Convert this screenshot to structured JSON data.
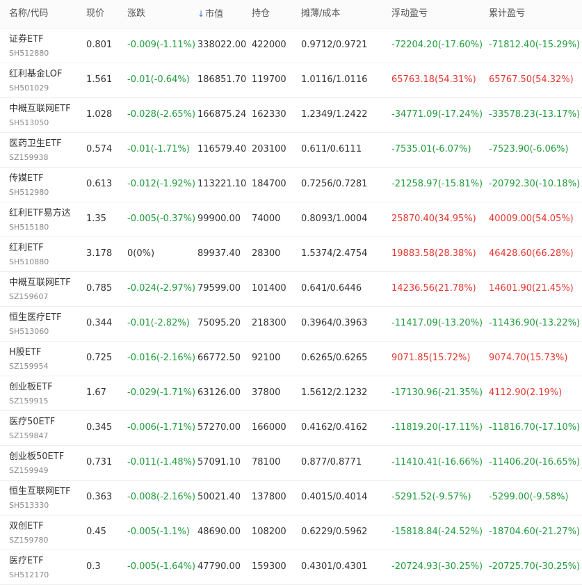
{
  "colors": {
    "up": "#e8362f",
    "down": "#1f9c3a",
    "flat": "#333333",
    "sort": "#2f7fd6"
  },
  "header": {
    "name_code": "名称/代码",
    "price": "现价",
    "change": "涨跌",
    "sort_icon": "↓",
    "market_value": "市值",
    "position": "持仓",
    "cost": "摊薄/成本",
    "float_pnl": "浮动盈亏",
    "total_pnl": "累计盈亏"
  },
  "rows": [
    {
      "name": "证券ETF",
      "code": "SH512880",
      "price": "0.801",
      "change": "-0.009(-1.11%)",
      "change_dir": "down",
      "mv": "338022.00",
      "pos": "422000",
      "cost": "0.9712/0.9721",
      "float": "-72204.20(-17.60%)",
      "float_dir": "down",
      "total": "-71812.40(-15.29%)",
      "total_dir": "down"
    },
    {
      "name": "红利基金LOF",
      "code": "SH501029",
      "price": "1.561",
      "change": "-0.01(-0.64%)",
      "change_dir": "down",
      "mv": "186851.70",
      "pos": "119700",
      "cost": "1.0116/1.0116",
      "float": "65763.18(54.31%)",
      "float_dir": "up",
      "total": "65767.50(54.32%)",
      "total_dir": "up"
    },
    {
      "name": "中概互联网ETF",
      "code": "SH513050",
      "price": "1.028",
      "change": "-0.028(-2.65%)",
      "change_dir": "down",
      "mv": "166875.24",
      "pos": "162330",
      "cost": "1.2349/1.2422",
      "float": "-34771.09(-17.24%)",
      "float_dir": "down",
      "total": "-33578.23(-13.17%)",
      "total_dir": "down"
    },
    {
      "name": "医药卫生ETF",
      "code": "SZ159938",
      "price": "0.574",
      "change": "-0.01(-1.71%)",
      "change_dir": "down",
      "mv": "116579.40",
      "pos": "203100",
      "cost": "0.611/0.6111",
      "float": "-7535.01(-6.07%)",
      "float_dir": "down",
      "total": "-7523.90(-6.06%)",
      "total_dir": "down"
    },
    {
      "name": "传媒ETF",
      "code": "SH512980",
      "price": "0.613",
      "change": "-0.012(-1.92%)",
      "change_dir": "down",
      "mv": "113221.10",
      "pos": "184700",
      "cost": "0.7256/0.7281",
      "float": "-21258.97(-15.81%)",
      "float_dir": "down",
      "total": "-20792.30(-10.18%)",
      "total_dir": "down"
    },
    {
      "name": "红利ETF易方达",
      "code": "SH515180",
      "price": "1.35",
      "change": "-0.005(-0.37%)",
      "change_dir": "down",
      "mv": "99900.00",
      "pos": "74000",
      "cost": "0.8093/1.0004",
      "float": "25870.40(34.95%)",
      "float_dir": "up",
      "total": "40009.00(54.05%)",
      "total_dir": "up"
    },
    {
      "name": "红利ETF",
      "code": "SH510880",
      "price": "3.178",
      "change": "0(0%)",
      "change_dir": "flat",
      "mv": "89937.40",
      "pos": "28300",
      "cost": "1.5374/2.4754",
      "float": "19883.58(28.38%)",
      "float_dir": "up",
      "total": "46428.60(66.28%)",
      "total_dir": "up"
    },
    {
      "name": "中概互联网ETF",
      "code": "SZ159607",
      "price": "0.785",
      "change": "-0.024(-2.97%)",
      "change_dir": "down",
      "mv": "79599.00",
      "pos": "101400",
      "cost": "0.641/0.6446",
      "float": "14236.56(21.78%)",
      "float_dir": "up",
      "total": "14601.90(21.45%)",
      "total_dir": "up"
    },
    {
      "name": "恒生医疗ETF",
      "code": "SH513060",
      "price": "0.344",
      "change": "-0.01(-2.82%)",
      "change_dir": "down",
      "mv": "75095.20",
      "pos": "218300",
      "cost": "0.3964/0.3963",
      "float": "-11417.09(-13.20%)",
      "float_dir": "down",
      "total": "-11436.90(-13.22%)",
      "total_dir": "down"
    },
    {
      "name": "H股ETF",
      "code": "SZ159954",
      "price": "0.725",
      "change": "-0.016(-2.16%)",
      "change_dir": "down",
      "mv": "66772.50",
      "pos": "92100",
      "cost": "0.6265/0.6265",
      "float": "9071.85(15.72%)",
      "float_dir": "up",
      "total": "9074.70(15.73%)",
      "total_dir": "up"
    },
    {
      "name": "创业板ETF",
      "code": "SZ159915",
      "price": "1.67",
      "change": "-0.029(-1.71%)",
      "change_dir": "down",
      "mv": "63126.00",
      "pos": "37800",
      "cost": "1.5612/2.1232",
      "float": "-17130.96(-21.35%)",
      "float_dir": "down",
      "total": "4112.90(2.19%)",
      "total_dir": "up"
    },
    {
      "name": "医疗50ETF",
      "code": "SZ159847",
      "price": "0.345",
      "change": "-0.006(-1.71%)",
      "change_dir": "down",
      "mv": "57270.00",
      "pos": "166000",
      "cost": "0.4162/0.4162",
      "float": "-11819.20(-17.11%)",
      "float_dir": "down",
      "total": "-11816.70(-17.10%)",
      "total_dir": "down"
    },
    {
      "name": "创业板50ETF",
      "code": "SZ159949",
      "price": "0.731",
      "change": "-0.011(-1.48%)",
      "change_dir": "down",
      "mv": "57091.10",
      "pos": "78100",
      "cost": "0.877/0.8771",
      "float": "-11410.41(-16.66%)",
      "float_dir": "down",
      "total": "-11406.20(-16.65%)",
      "total_dir": "down"
    },
    {
      "name": "恒生互联网ETF",
      "code": "SH513330",
      "price": "0.363",
      "change": "-0.008(-2.16%)",
      "change_dir": "down",
      "mv": "50021.40",
      "pos": "137800",
      "cost": "0.4015/0.4014",
      "float": "-5291.52(-9.57%)",
      "float_dir": "down",
      "total": "-5299.00(-9.58%)",
      "total_dir": "down"
    },
    {
      "name": "双创ETF",
      "code": "SZ159780",
      "price": "0.45",
      "change": "-0.005(-1.1%)",
      "change_dir": "down",
      "mv": "48690.00",
      "pos": "108200",
      "cost": "0.6229/0.5962",
      "float": "-15818.84(-24.52%)",
      "float_dir": "down",
      "total": "-18704.60(-21.27%)",
      "total_dir": "down"
    },
    {
      "name": "医疗ETF",
      "code": "SH512170",
      "price": "0.3",
      "change": "-0.005(-1.64%)",
      "change_dir": "down",
      "mv": "47790.00",
      "pos": "159300",
      "cost": "0.4301/0.4301",
      "float": "-20724.93(-30.25%)",
      "float_dir": "down",
      "total": "-20725.70(-30.25%)",
      "total_dir": "down"
    }
  ]
}
